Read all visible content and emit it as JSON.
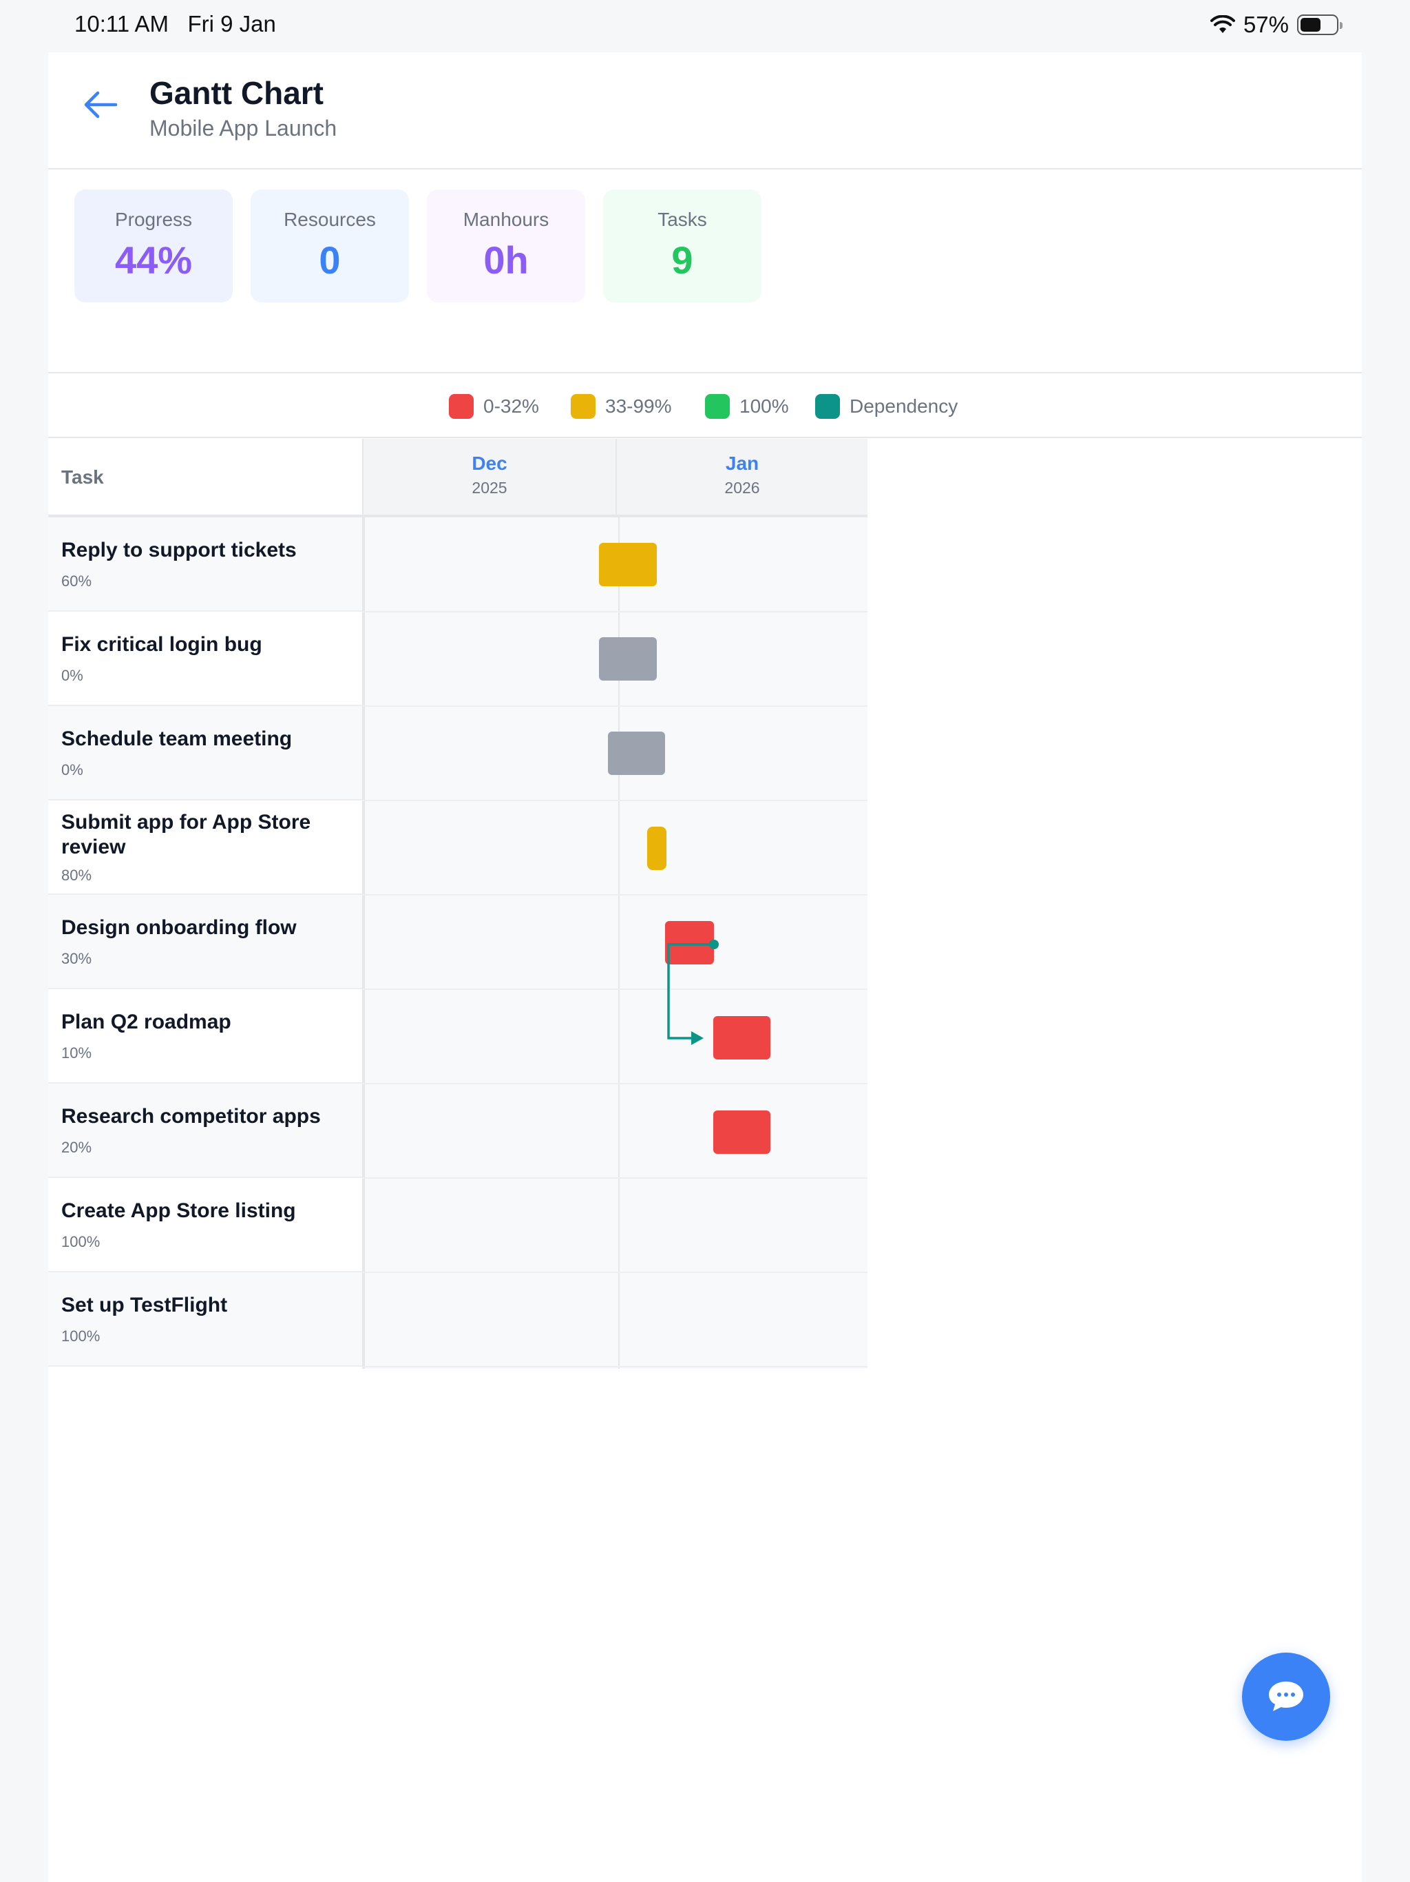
{
  "status": {
    "time": "10:11 AM",
    "date": "Fri 9 Jan",
    "battery": "57%",
    "battery_level": 0.57
  },
  "header": {
    "title": "Gantt Chart",
    "subtitle": "Mobile App Launch"
  },
  "stats": [
    {
      "label": "Progress",
      "value": "44%",
      "color": "#8b5cf6",
      "bg": "#eef2ff"
    },
    {
      "label": "Resources",
      "value": "0",
      "color": "#3b82f6",
      "bg": "#eff6ff"
    },
    {
      "label": "Manhours",
      "value": "0h",
      "color": "#8b5cf6",
      "bg": "#faf5ff"
    },
    {
      "label": "Tasks",
      "value": "9",
      "color": "#22c55e",
      "bg": "#f0fdf4"
    }
  ],
  "legend": [
    {
      "label": "0-32%",
      "color": "#ef4444"
    },
    {
      "label": "33-99%",
      "color": "#eab308"
    },
    {
      "label": "100%",
      "color": "#22c55e"
    },
    {
      "label": "Dependency",
      "color": "#0d9488"
    }
  ],
  "gantt": {
    "task_header": "Task",
    "months": [
      {
        "name": "Dec",
        "year": "2025"
      },
      {
        "name": "Jan",
        "year": "2026"
      }
    ],
    "tasks": [
      {
        "name": "Reply to support tickets",
        "progress": "60%",
        "color": "#eab308"
      },
      {
        "name": "Fix critical login bug",
        "progress": "0%",
        "color": "#9ca3af"
      },
      {
        "name": "Schedule team meeting",
        "progress": "0%",
        "color": "#9ca3af"
      },
      {
        "name": "Submit app for App Store review",
        "progress": "80%",
        "color": "#eab308"
      },
      {
        "name": "Design onboarding flow",
        "progress": "30%",
        "color": "#ef4444"
      },
      {
        "name": "Plan Q2 roadmap",
        "progress": "10%",
        "color": "#ef4444"
      },
      {
        "name": "Research competitor apps",
        "progress": "20%",
        "color": "#ef4444"
      },
      {
        "name": "Create App Store listing",
        "progress": "100%",
        "color": null
      },
      {
        "name": "Set up TestFlight",
        "progress": "100%",
        "color": null
      }
    ],
    "dependency": {
      "from": "Design onboarding flow",
      "to": "Plan Q2 roadmap",
      "color": "#0d9488"
    }
  },
  "fab": {
    "icon": "chat-bubble-icon"
  }
}
